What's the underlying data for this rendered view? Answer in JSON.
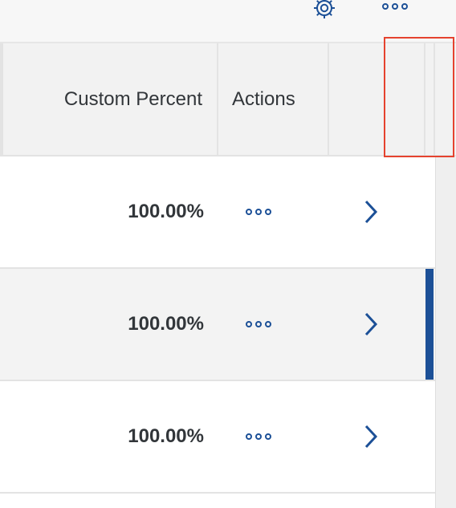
{
  "toolbar": {
    "settings_icon": "gear-icon",
    "more_icon": "more-horizontal-icon"
  },
  "table": {
    "columns": [
      {
        "key": "custom_percent",
        "label": "Custom Percent"
      },
      {
        "key": "actions",
        "label": "Actions"
      },
      {
        "key": "navigation",
        "label": ""
      }
    ],
    "rows": [
      {
        "custom_percent": "100.00%",
        "selected": false
      },
      {
        "custom_percent": "100.00%",
        "selected": true
      },
      {
        "custom_percent": "100.00%",
        "selected": false
      }
    ]
  },
  "colors": {
    "accent": "#1c5097",
    "highlight": "#e5432f",
    "text": "#32363a"
  }
}
